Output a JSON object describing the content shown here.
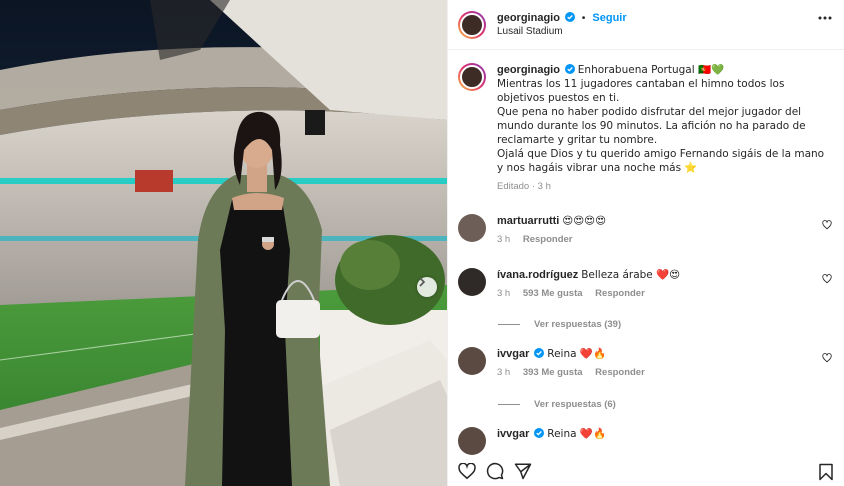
{
  "post": {
    "author": "georginagio",
    "follow_label": "Seguir",
    "location": "Lusail Stadium",
    "caption_lines": [
      "Enhorabuena Portugal 🇵🇹💚",
      "Mientras los 11 jugadores cantaban el himno todos los objetivos puestos en ti.",
      "Que pena no haber podido disfrutar del mejor jugador del mundo durante los 90 minutos. La afición no ha parado de reclamarte y gritar tu nombre.",
      "Ojalá que Dios y tu querido amigo Fernando sigáis de la mano y nos hagáis vibrar una noche más ⭐"
    ],
    "caption_meta": "Editado · 3 h"
  },
  "comments": [
    {
      "user": "martuarrutti",
      "verified": false,
      "text": "😍😍😍😍",
      "time": "3 h",
      "likes": "",
      "reply_label": "Responder"
    },
    {
      "user": "ívana.rodríguez",
      "verified": false,
      "text": "Belleza árabe ❤️😍",
      "time": "3 h",
      "likes": "593 Me gusta",
      "reply_label": "Responder",
      "view_replies": "Ver respuestas (39)"
    },
    {
      "user": "ivvgar",
      "verified": true,
      "text": "Reina ❤️🔥",
      "time": "3 h",
      "likes": "393 Me gusta",
      "reply_label": "Responder",
      "view_replies": "Ver respuestas (6)"
    },
    {
      "user": "ivvgar",
      "verified": true,
      "text": "Reina ❤️🔥",
      "time": "",
      "likes": "",
      "reply_label": ""
    }
  ],
  "colors": {
    "accent": "#0095f6",
    "verified": "#0095f6",
    "muted": "#8e8e8e",
    "stadium_sky": "#0c1a2c",
    "pitch": "#3f8f34",
    "dress_jacket": "#6d7a58"
  },
  "icons": [
    "more-icon",
    "heart-icon",
    "comment-icon",
    "share-icon",
    "bookmark-icon",
    "chevron-right-icon",
    "verified-icon"
  ]
}
